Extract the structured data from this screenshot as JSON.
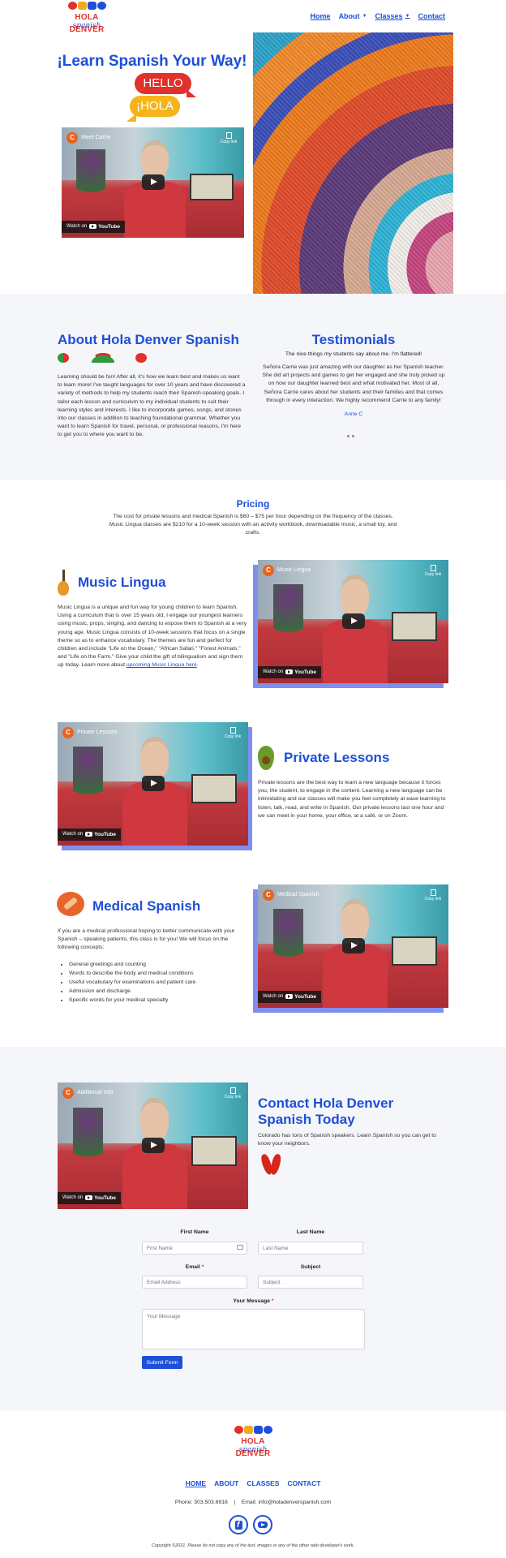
{
  "header": {
    "logo_name": "HOLA DENVER",
    "logo_sub": "spanish",
    "nav": [
      {
        "label": "Home"
      },
      {
        "label": "About"
      },
      {
        "label": "Classes"
      },
      {
        "label": "Contact"
      }
    ]
  },
  "hero": {
    "title": "¡Learn Spanish Your Way!",
    "bubble_hello": "HELLO",
    "bubble_hola": "¡HOLA",
    "video": {
      "channel_initial": "C",
      "title": "Meet Carrie",
      "copy_link": "Copy link",
      "watch_on": "Watch on",
      "youtube": "YouTube"
    }
  },
  "about": {
    "title": "About Hola Denver Spanish",
    "text": "Learning should be fun! After all, it's how we learn best and makes us want to learn more! I've taught languages for over 10 years and have discovered a variety of methods to help my students reach their Spanish-speaking goals. I tailor each lesson and curriculum to my individual students to suit their learning styles and interests. I like to incorporate games, songs, and stories into our classes in addition to teaching foundational grammar. Whether you want to learn Spanish for travel, personal, or professional reasons, I'm here to get you to where you want to be."
  },
  "testimonials": {
    "title": "Testimonials",
    "intro": "The nice things my students say about me. I'm flattered!",
    "text": "Señora Carrie was just amazing with our daughter as her Spanish teacher. She did art projects and games to get her engaged and she truly picked up on how our daughter learned best and what motivated her. Most of all, Señora Carrie cares about her students and their families and that comes through in every interaction. We highly recommend Carrie to any family!",
    "author": "Anne C"
  },
  "pricing": {
    "title": "Pricing",
    "text": "The cost for private lessons and medical Spanish is $60 – $75 per hour depending on the frequency of the classes. Music Lingua classes are $210 for a 10-week session with an activity workbook, downloadable music, a small toy, and crafts."
  },
  "music": {
    "title": "Music Lingua",
    "text": "Music Lingua is a unique and fun way for young children to learn Spanish. Using a curriculum that is over 15 years old, I engage our youngest learners using music, props, singing, and dancing to expose them to Spanish at a very young age. Music Lingua consists of 10-week sessions that focus on a single theme so as to enhance vocabulary. The themes are fun and perfect for children and include \"Life on the Ocean,\" \"African Safari,\" \"Forest Animals,\" and \"Life on the Farm.\" Give your child the gift of bilingualism and sign them up today. Learn more about ",
    "link": "upcoming Music Lingua here",
    "link_end": ".",
    "video": {
      "channel_initial": "C",
      "title": "Music Lingua",
      "copy_link": "Copy link",
      "watch_on": "Watch on",
      "youtube": "YouTube"
    }
  },
  "private": {
    "title": "Private Lessons",
    "text": "Private lessons are the best way to learn a new language because it forces you, the student, to engage in the content. Learning a new language can be intimidating and our classes will make you feel completely at ease learning to listen, talk, read, and write in Spanish. Our private lessons last one hour and we can meet in your home, your office, at a café, or on Zoom.",
    "video": {
      "channel_initial": "C",
      "title": "Private Lessons",
      "copy_link": "Copy link",
      "watch_on": "Watch on",
      "youtube": "YouTube"
    }
  },
  "medical": {
    "title": "Medical Spanish",
    "text": "If you are a medical professional hoping to better communicate with your Spanish – speaking patients, this class is for you! We will focus on the following concepts:",
    "list": [
      "General greetings and counting",
      "Words to describe the body and medical conditions",
      "Useful vocabulary for examinations and patient care",
      "Admission and discharge",
      "Specific words for your medical specialty"
    ],
    "video": {
      "channel_initial": "C",
      "title": "Medical Spanish",
      "copy_link": "Copy link",
      "watch_on": "Watch on",
      "youtube": "YouTube"
    }
  },
  "contact": {
    "title": "Contact Hola Denver Spanish Today",
    "text": "Colorado has tons of Spanish speakers. Learn Spanish so you can get to know your neighbors.",
    "video": {
      "channel_initial": "C",
      "title": "Additional Info",
      "copy_link": "Copy link",
      "watch_on": "Watch on",
      "youtube": "YouTube"
    }
  },
  "form": {
    "first_name_label": "First Name",
    "first_name_placeholder": "First Name",
    "last_name_label": "Last Name",
    "last_name_placeholder": "Last Name",
    "email_label": "Email",
    "email_placeholder": "Email Address",
    "subject_label": "Subject",
    "subject_placeholder": "Subject",
    "message_label": "Your Message",
    "message_placeholder": "Your Message",
    "required_mark": "*",
    "submit_label": "Submit Form"
  },
  "footer": {
    "logo_name": "HOLA DENVER",
    "logo_sub": "spanish",
    "nav": [
      "HOME",
      "ABOUT",
      "CLASSES",
      "CONTACT"
    ],
    "phone": "Phone: 303.503.6916",
    "separator": "|",
    "email": "Email: info@holadenverspanish.com",
    "copyright": "Copyright ©2021. Please do not copy any of the text, images or any of the other web developer's work."
  },
  "colors": {
    "brand_blue": "#1d4fd8",
    "brand_red": "#e0312b",
    "brand_yellow": "#f4b41a",
    "band_bg": "#f5f6f9"
  },
  "icons": [
    "maracas-sombrero-icon",
    "guitar-icon",
    "avocado-icon",
    "bandage-heart-icon",
    "chili-peppers-icon",
    "facebook-icon",
    "youtube-icon",
    "play-icon",
    "copy-link-icon"
  ]
}
